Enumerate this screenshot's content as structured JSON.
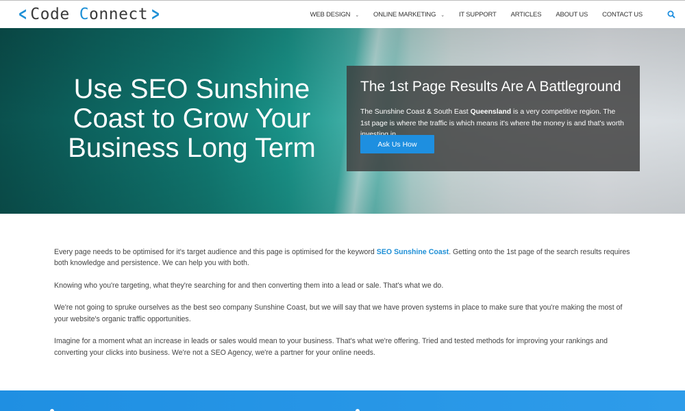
{
  "logo": {
    "left": "Code",
    "right": "onnect",
    "c": "C"
  },
  "nav": {
    "items": [
      {
        "label": "WEB DESIGN",
        "dropdown": true
      },
      {
        "label": "ONLINE MARKETING",
        "dropdown": true
      },
      {
        "label": "IT SUPPORT",
        "dropdown": false
      },
      {
        "label": "ARTICLES",
        "dropdown": false
      },
      {
        "label": "ABOUT US",
        "dropdown": false
      },
      {
        "label": "CONTACT US",
        "dropdown": false
      }
    ],
    "search_icon": "search-icon"
  },
  "hero": {
    "title": "Use SEO Sunshine Coast to Grow Your Business Long Term",
    "box_title": "The 1st Page Results Are A Battleground",
    "box_text_pre": "The Sunshine Coast & South East ",
    "box_text_bold": "Queensland",
    "box_text_post": " is a very competitive region.  The 1st page is where the traffic is which means it's where the money is and that's worth investing in.",
    "cta_label": "Ask Us How"
  },
  "content": {
    "p1_pre": "Every page needs to be optimised for it's target audience and this page is optimised for the keyword ",
    "p1_link": "SEO Sunshine Coast",
    "p1_post": ".  Getting onto the 1st page of the search results requires both knowledge and persistence.  We can help you with both.",
    "p2": "Knowing who you're targeting, what they're searching for and then converting them into a lead or sale.  That's what we do.",
    "p3": "We're not going to spruke ourselves as the best seo company Sunshine Coast, but we will say that we have proven systems in place to make sure that you're making the most of your website's organic traffic opportunities.",
    "p4": "Imagine for a moment what an increase in leads or sales would mean to your business.  That's what we're offering.  Tried and tested methods for improving your rankings and converting your clicks into business.  We're not a SEO Agency, we're a partner for your online needs."
  },
  "colors": {
    "accent": "#1e8fe0",
    "link": "#1e8fd6",
    "band": "#2392e4"
  }
}
